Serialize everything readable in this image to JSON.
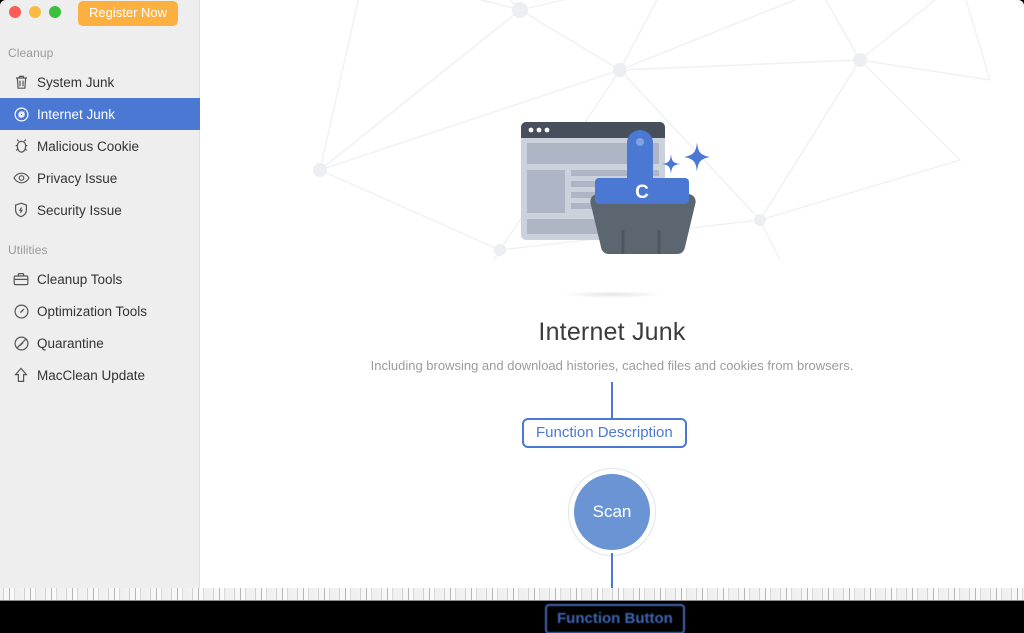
{
  "window": {
    "traffic_lights": [
      {
        "name": "close",
        "color": "#fc5b57"
      },
      {
        "name": "minimize",
        "color": "#f9bc40"
      },
      {
        "name": "zoom",
        "color": "#3ac03a"
      }
    ],
    "register_label": "Register Now"
  },
  "sidebar": {
    "groups": [
      {
        "title": "Cleanup",
        "items": [
          {
            "label": "System Junk",
            "icon": "trash-icon",
            "active": false
          },
          {
            "label": "Internet Junk",
            "icon": "compass-icon",
            "active": true
          },
          {
            "label": "Malicious Cookie",
            "icon": "bug-icon",
            "active": false
          },
          {
            "label": "Privacy Issue",
            "icon": "eye-icon",
            "active": false
          },
          {
            "label": "Security Issue",
            "icon": "shield-icon",
            "active": false
          }
        ]
      },
      {
        "title": "Utilities",
        "items": [
          {
            "label": "Cleanup Tools",
            "icon": "briefcase-icon",
            "active": false
          },
          {
            "label": "Optimization Tools",
            "icon": "gauge-icon",
            "active": false
          },
          {
            "label": "Quarantine",
            "icon": "prohibited-icon",
            "active": false
          },
          {
            "label": "MacClean Update",
            "icon": "up-arrow-icon",
            "active": false
          }
        ]
      }
    ]
  },
  "main": {
    "illustration_name": "browser-window-with-brush-illustration",
    "title": "Internet Junk",
    "subtitle": "Including browsing and download histories, cached files and cookies from browsers.",
    "scan_label": "Scan"
  },
  "annotations": {
    "description_callout": "Function Description",
    "button_callout": "Function Button"
  },
  "colors": {
    "accent": "#4a78d2",
    "scan_fill": "#6a94d4",
    "register": "#fcb040",
    "sidebar_bg": "#eeeeee",
    "title_text": "#3c3c3c",
    "subtitle_text": "#9b9b9b"
  }
}
